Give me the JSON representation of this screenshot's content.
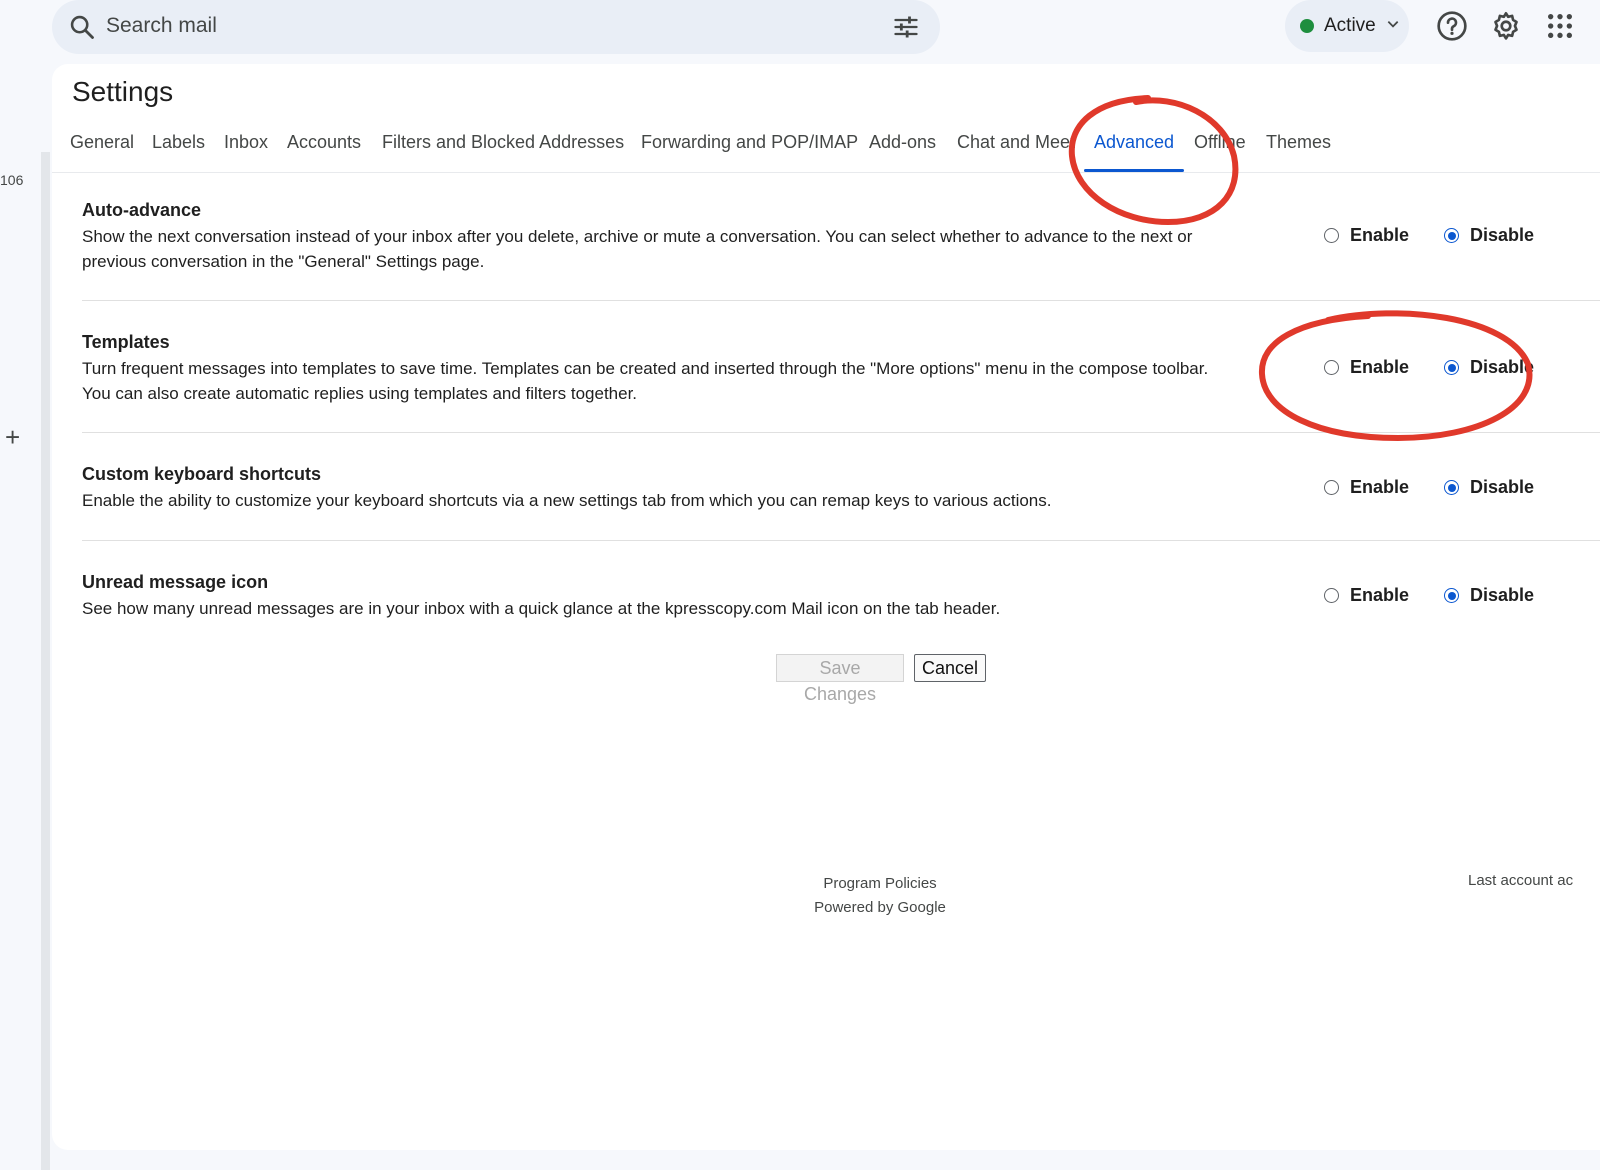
{
  "rail": {
    "count": "106",
    "plus": "+"
  },
  "search": {
    "placeholder": "Search mail"
  },
  "status": {
    "label": "Active",
    "color": "#1e8e3e"
  },
  "icons": {
    "search": "search-icon",
    "filter": "tune-icon",
    "caret": "chevron-down-icon",
    "help": "help-icon",
    "settings": "gear-icon",
    "apps": "apps-grid-icon"
  },
  "settings": {
    "title": "Settings",
    "tabs": [
      {
        "label": "General"
      },
      {
        "label": "Labels"
      },
      {
        "label": "Inbox"
      },
      {
        "label": "Accounts"
      },
      {
        "label": "Filters and Blocked Addresses"
      },
      {
        "label": "Forwarding and POP/IMAP"
      },
      {
        "label": "Add-ons"
      },
      {
        "label": "Chat and Meet"
      },
      {
        "label": "Advanced",
        "active": true
      },
      {
        "label": "Offline"
      },
      {
        "label": "Themes"
      }
    ],
    "rows": [
      {
        "title": "Auto-advance",
        "description": "Show the next conversation instead of your inbox after you delete, archive or mute a conversation. You can select whether to advance to the next or previous conversation in the \"General\" Settings page.",
        "enable_label": "Enable",
        "disable_label": "Disable",
        "selected": "Disable"
      },
      {
        "title": "Templates",
        "description": "Turn frequent messages into templates to save time. Templates can be created and inserted through the \"More options\" menu in the compose toolbar. You can also create automatic replies using templates and filters together.",
        "enable_label": "Enable",
        "disable_label": "Disable",
        "selected": "Disable"
      },
      {
        "title": "Custom keyboard shortcuts",
        "description": "Enable the ability to customize your keyboard shortcuts via a new settings tab from which you can remap keys to various actions.",
        "enable_label": "Enable",
        "disable_label": "Disable",
        "selected": "Disable"
      },
      {
        "title": "Unread message icon",
        "description": "See how many unread messages are in your inbox with a quick glance at the kpresscopy.com Mail icon on the tab header.",
        "enable_label": "Enable",
        "disable_label": "Disable",
        "selected": "Disable"
      }
    ],
    "buttons": {
      "save": "Save Changes",
      "cancel": "Cancel"
    }
  },
  "footer": {
    "program_policies": "Program Policies",
    "powered_by": "Powered by Google",
    "last_activity": "Last account ac"
  },
  "colors": {
    "accent": "#0b57d0",
    "annotation": "#e0392b"
  }
}
